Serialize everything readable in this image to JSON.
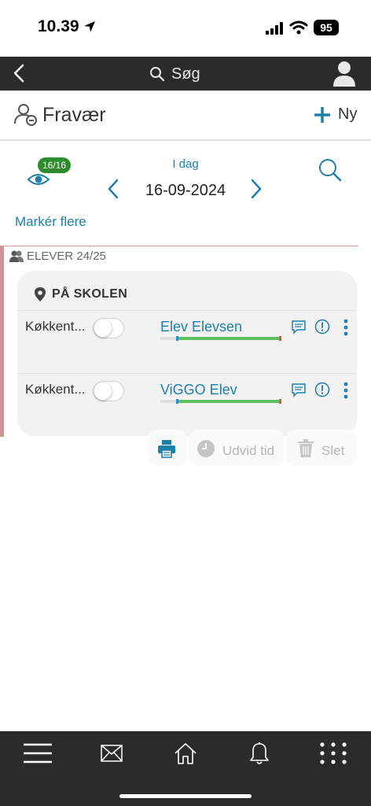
{
  "status_bar": {
    "time": "10.39",
    "battery": "95"
  },
  "top_nav": {
    "search_label": "Søg"
  },
  "header": {
    "title": "Fravær",
    "new_label": "Ny"
  },
  "date_nav": {
    "counter": "16/16",
    "today_label": "I dag",
    "date": "16-09-2024"
  },
  "mark_many_label": "Markér flere",
  "group": {
    "label": "ELEVER 24/25"
  },
  "card": {
    "title": "PÅ SKOLEN",
    "rows": [
      {
        "label": "Køkkent...",
        "student": "Elev Elevsen",
        "present": false
      },
      {
        "label": "Køkkent...",
        "student": "ViGGO Elev",
        "present": false
      }
    ]
  },
  "actions": {
    "extend_label": "Udvid tid",
    "delete_label": "Slet"
  },
  "colors": {
    "accent": "#1e7fa8",
    "nav_dark": "#2b2b2b",
    "badge_green": "#2e8b2e",
    "card_bg": "#f2f2f2"
  }
}
